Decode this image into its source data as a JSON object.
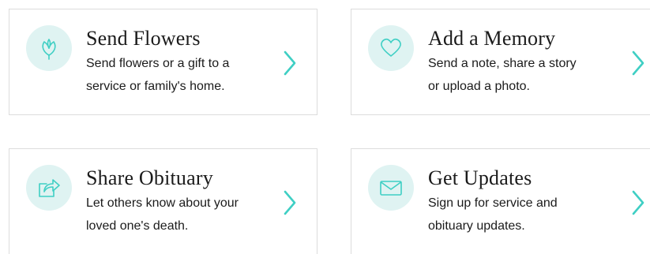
{
  "accent_color": "#3fcfc4",
  "icon_bg_color": "#dff3f2",
  "cards": [
    {
      "title": "Send Flowers",
      "line1": "Send flowers or a gift to a",
      "line2": "service or family's home.",
      "icon": "flower-icon"
    },
    {
      "title": "Add a Memory",
      "line1": "Send a note, share a story",
      "line2": "or upload a photo.",
      "icon": "heart-icon"
    },
    {
      "title": "Share Obituary",
      "line1": "Let others know about your",
      "line2": "loved one's death.",
      "icon": "share-icon"
    },
    {
      "title": "Get Updates",
      "line1": "Sign up for service and",
      "line2": "obituary updates.",
      "icon": "envelope-icon"
    }
  ]
}
